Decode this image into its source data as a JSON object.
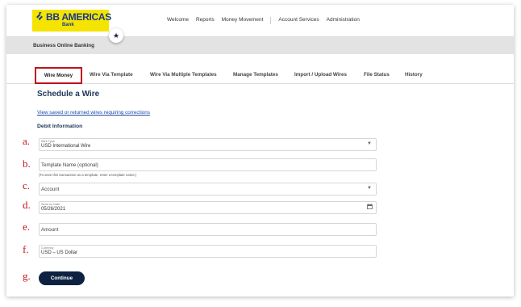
{
  "brand": {
    "name": "BB AMERICAS",
    "sub": "Bank",
    "logo_icon": "bb-logo-icon",
    "color_bg": "#f4e400",
    "color_text": "#1a3a8f"
  },
  "favorite_icon": "star-icon",
  "topnav": [
    "Welcome",
    "Reports",
    "Money Movement",
    "Account Services",
    "Administration"
  ],
  "subbar": {
    "title": "Business Online Banking"
  },
  "tabs": [
    "Wire Money",
    "Wire Via Template",
    "Wire Via Multiple Templates",
    "Manage Templates",
    "Import / Upload Wires",
    "File Status",
    "History"
  ],
  "page": {
    "heading": "Schedule a Wire",
    "link": "View saved or returned wires requiring corrections",
    "section": "Debit Information"
  },
  "markers": [
    "a.",
    "b.",
    "c.",
    "d.",
    "e.",
    "f.",
    "g."
  ],
  "form": {
    "wire_type": {
      "label": "Wire Type",
      "value": "USD International Wire"
    },
    "template_name": {
      "placeholder": "Template Name (optional)",
      "hint": "(To save this transaction as a template, enter a template name.)"
    },
    "account": {
      "placeholder": "Account"
    },
    "send_on_date": {
      "label": "Send on Date",
      "value": "05/26/2021"
    },
    "amount": {
      "placeholder": "Amount"
    },
    "currency": {
      "label": "Currency",
      "value": "USD – US Dollar"
    }
  },
  "actions": {
    "continue": "Continue"
  },
  "colors": {
    "accent_red": "#c0131c",
    "navy": "#0d2240",
    "link": "#1a4aa8"
  }
}
